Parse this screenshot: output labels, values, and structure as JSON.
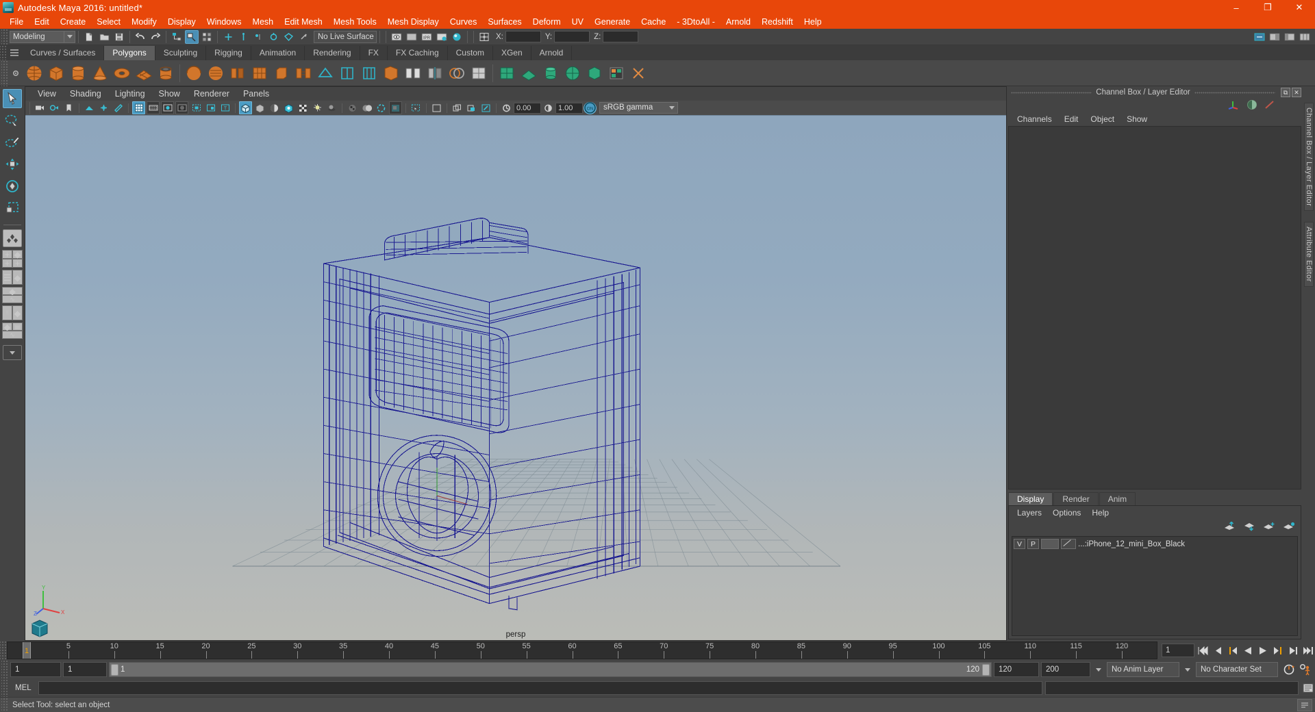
{
  "window": {
    "title": "Autodesk Maya 2016: untitled*",
    "app_icon": "maya-logo-icon",
    "minimize": "–",
    "maximize": "❐",
    "close": "✕"
  },
  "menubar": {
    "items": [
      {
        "label": "File"
      },
      {
        "label": "Edit"
      },
      {
        "label": "Create"
      },
      {
        "label": "Select"
      },
      {
        "label": "Modify"
      },
      {
        "label": "Display"
      },
      {
        "label": "Windows"
      },
      {
        "label": "Mesh"
      },
      {
        "label": "Edit Mesh"
      },
      {
        "label": "Mesh Tools"
      },
      {
        "label": "Mesh Display"
      },
      {
        "label": "Curves"
      },
      {
        "label": "Surfaces"
      },
      {
        "label": "Deform"
      },
      {
        "label": "UV"
      },
      {
        "label": "Generate"
      },
      {
        "label": "Cache"
      },
      {
        "label": "- 3DtoAll -"
      },
      {
        "label": "Arnold"
      },
      {
        "label": "Redshift"
      },
      {
        "label": "Help"
      }
    ]
  },
  "statusline": {
    "menuset": "Modeling",
    "live_surface": "No Live Surface",
    "x_label": "X:",
    "y_label": "Y:",
    "z_label": "Z:",
    "x_value": "",
    "y_value": "",
    "z_value": ""
  },
  "shelf": {
    "tabs": [
      {
        "label": "Curves / Surfaces",
        "active": false
      },
      {
        "label": "Polygons",
        "active": true
      },
      {
        "label": "Sculpting",
        "active": false
      },
      {
        "label": "Rigging",
        "active": false
      },
      {
        "label": "Animation",
        "active": false
      },
      {
        "label": "Rendering",
        "active": false
      },
      {
        "label": "FX",
        "active": false
      },
      {
        "label": "FX Caching",
        "active": false
      },
      {
        "label": "Custom",
        "active": false
      },
      {
        "label": "XGen",
        "active": false
      },
      {
        "label": "Arnold",
        "active": false
      }
    ]
  },
  "toolbox": {
    "tools": [
      {
        "name": "select-tool",
        "selected": true
      },
      {
        "name": "lasso-select-tool",
        "selected": false
      },
      {
        "name": "paint-select-tool",
        "selected": false
      },
      {
        "name": "move-tool",
        "selected": false
      },
      {
        "name": "rotate-tool",
        "selected": false
      },
      {
        "name": "scale-tool",
        "selected": false
      }
    ]
  },
  "viewport": {
    "menus": [
      {
        "label": "View"
      },
      {
        "label": "Shading"
      },
      {
        "label": "Lighting"
      },
      {
        "label": "Show"
      },
      {
        "label": "Renderer"
      },
      {
        "label": "Panels"
      }
    ],
    "camera_label": "persp",
    "exposure": "0.00",
    "gamma": "1.00",
    "color_management_toggle": "ON",
    "view_transform": "sRGB gamma",
    "wireframe_color": "#1a1a8c",
    "bg_top": "#8fa7bd",
    "bg_bottom": "#b9bbb7"
  },
  "channel_box": {
    "panel_title": "Channel Box / Layer Editor",
    "menus": [
      {
        "label": "Channels"
      },
      {
        "label": "Edit"
      },
      {
        "label": "Object"
      },
      {
        "label": "Show"
      }
    ],
    "undock_icon": "⧉",
    "close_icon": "✕"
  },
  "layer_editor": {
    "tabs": [
      {
        "label": "Display",
        "active": true
      },
      {
        "label": "Render",
        "active": false
      },
      {
        "label": "Anim",
        "active": false
      }
    ],
    "menus": [
      {
        "label": "Layers"
      },
      {
        "label": "Options"
      },
      {
        "label": "Help"
      }
    ],
    "buttons": [
      {
        "name": "move-layer-up-icon"
      },
      {
        "name": "move-layer-down-icon"
      },
      {
        "name": "new-layer-icon"
      },
      {
        "name": "new-layer-from-selected-icon"
      }
    ],
    "layers": [
      {
        "visibility": "V",
        "playback": "P",
        "color": "",
        "name": "...:iPhone_12_mini_Box_Black"
      }
    ]
  },
  "side_tabs": [
    {
      "label": "Channel Box / Layer Editor"
    },
    {
      "label": "Attribute Editor"
    }
  ],
  "timeline": {
    "ticks": [
      5,
      10,
      15,
      20,
      25,
      30,
      35,
      40,
      45,
      50,
      55,
      60,
      65,
      70,
      75,
      80,
      85,
      90,
      95,
      100,
      105,
      110,
      115,
      120
    ],
    "current_frame": "1",
    "current_frame_marker": "1",
    "start": "1",
    "end": "120",
    "playback_buttons": [
      {
        "name": "go-to-start-button"
      },
      {
        "name": "step-back-keyframe-button"
      },
      {
        "name": "step-back-frame-button"
      },
      {
        "name": "play-backwards-button"
      },
      {
        "name": "play-forwards-button"
      },
      {
        "name": "step-forward-frame-button"
      },
      {
        "name": "step-forward-keyframe-button"
      },
      {
        "name": "go-to-end-button"
      }
    ]
  },
  "range": {
    "anim_start": "1",
    "range_start": "1",
    "slider_start": "1",
    "slider_end": "120",
    "range_end": "120",
    "anim_end": "200",
    "anim_layer": "No Anim Layer",
    "character_set": "No Character Set"
  },
  "command_line": {
    "language": "MEL",
    "value": "",
    "placeholder": ""
  },
  "status_bar": {
    "message": "Select Tool: select an object"
  }
}
